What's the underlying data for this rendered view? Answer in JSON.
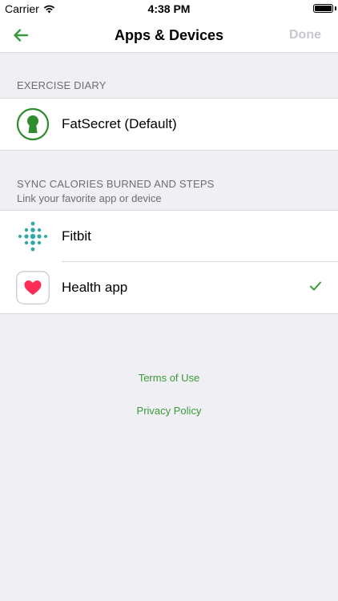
{
  "status_bar": {
    "carrier": "Carrier",
    "time": "4:38 PM"
  },
  "nav": {
    "title": "Apps & Devices",
    "done_label": "Done"
  },
  "exercise_diary": {
    "header": "EXERCISE DIARY",
    "items": [
      {
        "label": "FatSecret (Default)",
        "icon": "keyhole-icon"
      }
    ]
  },
  "sync": {
    "header": "SYNC CALORIES BURNED AND STEPS",
    "subheader": "Link your favorite app or device",
    "items": [
      {
        "label": "Fitbit",
        "icon": "fitbit-dots-icon",
        "selected": false
      },
      {
        "label": "Health app",
        "icon": "heart-icon",
        "selected": true
      }
    ]
  },
  "links": {
    "terms": "Terms of Use",
    "privacy": "Privacy Policy"
  },
  "colors": {
    "accent_green": "#3a9a3a",
    "fitbit_teal": "#2fa8a8",
    "health_pink": "#ff2d55"
  }
}
